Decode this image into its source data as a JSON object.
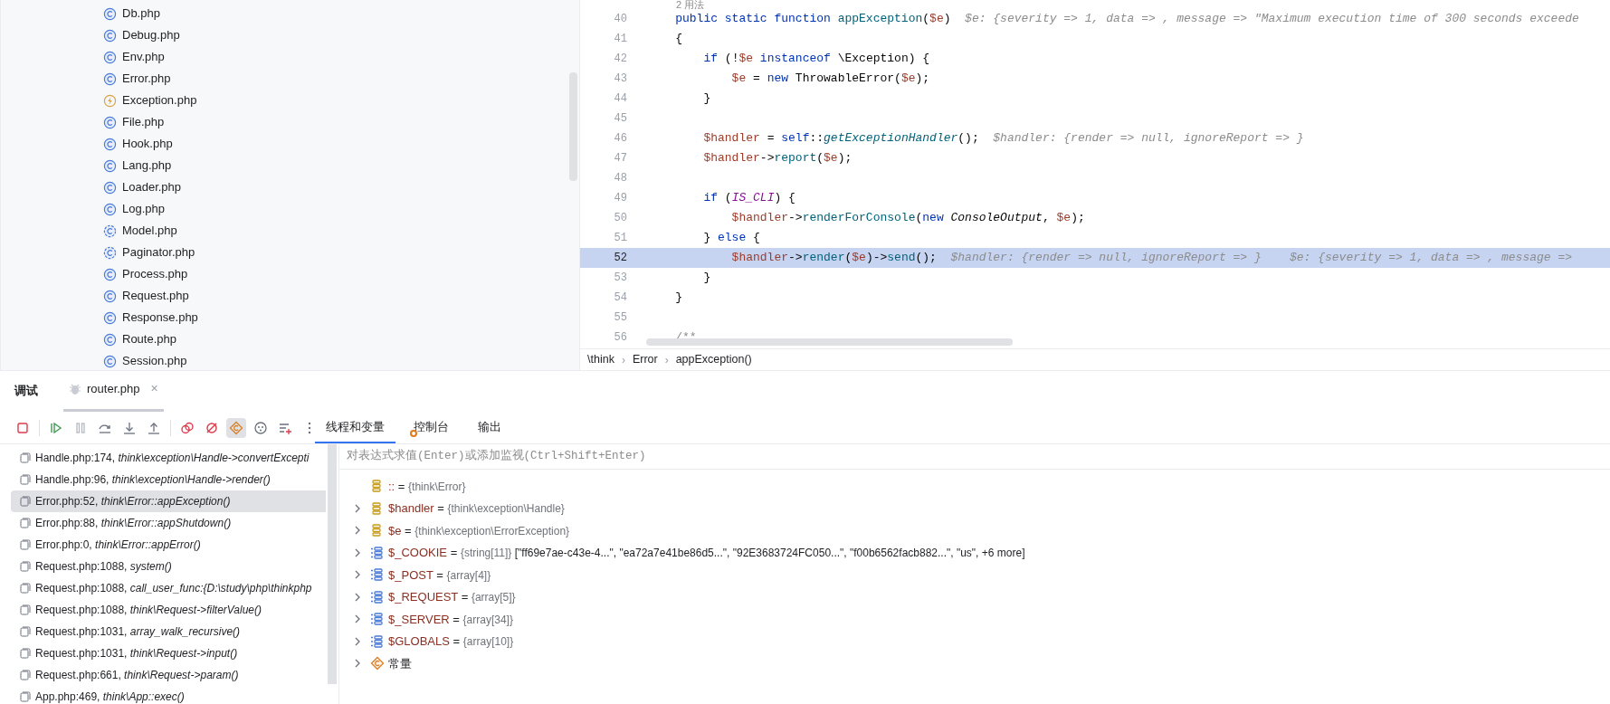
{
  "project_tree": {
    "files": [
      {
        "name": "Db.php",
        "kind": "class"
      },
      {
        "name": "Debug.php",
        "kind": "class"
      },
      {
        "name": "Env.php",
        "kind": "class"
      },
      {
        "name": "Error.php",
        "kind": "class"
      },
      {
        "name": "Exception.php",
        "kind": "exception"
      },
      {
        "name": "File.php",
        "kind": "class"
      },
      {
        "name": "Hook.php",
        "kind": "class"
      },
      {
        "name": "Lang.php",
        "kind": "class"
      },
      {
        "name": "Loader.php",
        "kind": "class"
      },
      {
        "name": "Log.php",
        "kind": "class"
      },
      {
        "name": "Model.php",
        "kind": "abstract"
      },
      {
        "name": "Paginator.php",
        "kind": "abstract"
      },
      {
        "name": "Process.php",
        "kind": "class"
      },
      {
        "name": "Request.php",
        "kind": "class"
      },
      {
        "name": "Response.php",
        "kind": "class"
      },
      {
        "name": "Route.php",
        "kind": "class"
      },
      {
        "name": "Session.php",
        "kind": "class"
      }
    ]
  },
  "editor": {
    "usages_hint": "2 用法",
    "lines": [
      {
        "number": "40",
        "current": false,
        "tokens": [
          {
            "text": "    public static function ",
            "kind": "kw"
          },
          {
            "text": "appException",
            "kind": "fn"
          },
          {
            "text": "(",
            "kind": "plain"
          },
          {
            "text": "$e",
            "kind": "var"
          },
          {
            "text": ")",
            "kind": "plain"
          },
          {
            "text": "  $e: {severity => 1, data => , message => \"Maximum execution time of 300 seconds exceede",
            "kind": "hint"
          }
        ]
      },
      {
        "number": "41",
        "current": false,
        "tokens": [
          {
            "text": "    {",
            "kind": "plain"
          }
        ]
      },
      {
        "number": "42",
        "current": false,
        "tokens": [
          {
            "text": "        if ",
            "kind": "kw"
          },
          {
            "text": "(!",
            "kind": "plain"
          },
          {
            "text": "$e",
            "kind": "var"
          },
          {
            "text": " instanceof ",
            "kind": "kw"
          },
          {
            "text": "\\Exception) {",
            "kind": "plain"
          }
        ]
      },
      {
        "number": "43",
        "current": false,
        "tokens": [
          {
            "text": "            $e",
            "kind": "var"
          },
          {
            "text": " = ",
            "kind": "plain"
          },
          {
            "text": "new ",
            "kind": "kw"
          },
          {
            "text": "ThrowableError(",
            "kind": "plain"
          },
          {
            "text": "$e",
            "kind": "var"
          },
          {
            "text": ");",
            "kind": "plain"
          }
        ]
      },
      {
        "number": "44",
        "current": false,
        "tokens": [
          {
            "text": "        }",
            "kind": "plain"
          }
        ]
      },
      {
        "number": "45",
        "current": false
      },
      {
        "number": "46",
        "current": false,
        "tokens": [
          {
            "text": "        $handler",
            "kind": "var"
          },
          {
            "text": " = ",
            "kind": "plain"
          },
          {
            "text": "self",
            "kind": "kw"
          },
          {
            "text": "::",
            "kind": "plain"
          },
          {
            "text": "getExceptionHandler",
            "kind": "static-call"
          },
          {
            "text": "();",
            "kind": "plain"
          },
          {
            "text": "  $handler: {render => null, ignoreReport => }",
            "kind": "hint"
          }
        ]
      },
      {
        "number": "47",
        "current": false,
        "tokens": [
          {
            "text": "        $handler",
            "kind": "var"
          },
          {
            "text": "->",
            "kind": "plain"
          },
          {
            "text": "report",
            "kind": "fn"
          },
          {
            "text": "(",
            "kind": "plain"
          },
          {
            "text": "$e",
            "kind": "var"
          },
          {
            "text": ");",
            "kind": "plain"
          }
        ]
      },
      {
        "number": "48",
        "current": false
      },
      {
        "number": "49",
        "current": false,
        "tokens": [
          {
            "text": "        if ",
            "kind": "kw"
          },
          {
            "text": "(",
            "kind": "plain"
          },
          {
            "text": "IS_CLI",
            "kind": "const"
          },
          {
            "text": ") {",
            "kind": "plain"
          }
        ]
      },
      {
        "number": "50",
        "current": false,
        "tokens": [
          {
            "text": "            $handler",
            "kind": "var"
          },
          {
            "text": "->",
            "kind": "plain"
          },
          {
            "text": "renderForConsole",
            "kind": "fn"
          },
          {
            "text": "(",
            "kind": "plain"
          },
          {
            "text": "new ",
            "kind": "kw"
          },
          {
            "text": "ConsoleOutput",
            "kind": "class-ref"
          },
          {
            "text": ", ",
            "kind": "plain"
          },
          {
            "text": "$e",
            "kind": "var"
          },
          {
            "text": ");",
            "kind": "plain"
          }
        ]
      },
      {
        "number": "51",
        "current": false,
        "tokens": [
          {
            "text": "        } ",
            "kind": "plain"
          },
          {
            "text": "else",
            "kind": "kw"
          },
          {
            "text": " {",
            "kind": "plain"
          }
        ]
      },
      {
        "number": "52",
        "current": true,
        "tokens": [
          {
            "text": "            $handler",
            "kind": "var"
          },
          {
            "text": "->",
            "kind": "plain"
          },
          {
            "text": "render",
            "kind": "fn"
          },
          {
            "text": "(",
            "kind": "plain"
          },
          {
            "text": "$e",
            "kind": "var"
          },
          {
            "text": ")->",
            "kind": "plain"
          },
          {
            "text": "send",
            "kind": "fn"
          },
          {
            "text": "();",
            "kind": "plain"
          },
          {
            "text": "  $handler: {render => null, ignoreReport => }    $e: {severity => 1, data => , message =>",
            "kind": "hint"
          }
        ]
      },
      {
        "number": "53",
        "current": false,
        "tokens": [
          {
            "text": "        }",
            "kind": "plain"
          }
        ]
      },
      {
        "number": "54",
        "current": false,
        "tokens": [
          {
            "text": "    }",
            "kind": "plain"
          }
        ]
      },
      {
        "number": "55",
        "current": false
      },
      {
        "number": "56",
        "current": false,
        "tokens": [
          {
            "text": "    /**",
            "kind": "comment"
          }
        ]
      }
    ],
    "breadcrumb": {
      "separator": "›",
      "items": [
        "\\think",
        "Error",
        "appException()"
      ]
    }
  },
  "debug_panel": {
    "title": "调试",
    "session_tab": {
      "label": "router.php",
      "selected": true,
      "close": "×"
    },
    "toolbar": [
      {
        "kind": "stop",
        "disabled": false,
        "selected": false
      },
      {
        "kind": "resume",
        "disabled": false,
        "selected": false
      },
      {
        "kind": "pause",
        "disabled": true,
        "selected": false
      },
      {
        "kind": "step-over",
        "disabled": false,
        "selected": false
      },
      {
        "kind": "step-into",
        "disabled": false,
        "selected": false
      },
      {
        "kind": "step-out",
        "disabled": false,
        "selected": false
      },
      {
        "kind": "breakpoints",
        "disabled": false,
        "selected": false
      },
      {
        "kind": "mute",
        "disabled": false,
        "selected": false
      },
      {
        "kind": "exceptions",
        "disabled": false,
        "selected": true
      },
      {
        "kind": "dots-circle",
        "disabled": false,
        "selected": false
      },
      {
        "kind": "add-list",
        "disabled": false,
        "selected": false
      },
      {
        "kind": "more",
        "disabled": false,
        "selected": false
      }
    ],
    "tabs": [
      {
        "label": "线程和变量",
        "selected": true,
        "badge": false
      },
      {
        "label": "控制台",
        "selected": false,
        "badge": true
      },
      {
        "label": "输出",
        "selected": false,
        "badge": false
      }
    ],
    "frames": [
      {
        "location": "Handle.php:174, ",
        "method": "think\\exception\\Handle->convertExcepti",
        "selected": false
      },
      {
        "location": "Handle.php:96, ",
        "method": "think\\exception\\Handle->render()",
        "selected": false
      },
      {
        "location": "Error.php:52, ",
        "method": "think\\Error::appException()",
        "selected": true
      },
      {
        "location": "Error.php:88, ",
        "method": "think\\Error::appShutdown()",
        "selected": false
      },
      {
        "location": "Error.php:0, ",
        "method": "think\\Error::appError()",
        "selected": false
      },
      {
        "location": "Request.php:1088, ",
        "method": "system()",
        "selected": false
      },
      {
        "location": "Request.php:1088, ",
        "method": "call_user_func:{D:\\study\\php\\thinkphp",
        "selected": false
      },
      {
        "location": "Request.php:1088, ",
        "method": "think\\Request->filterValue()",
        "selected": false
      },
      {
        "location": "Request.php:1031, ",
        "method": "array_walk_recursive()",
        "selected": false
      },
      {
        "location": "Request.php:1031, ",
        "method": "think\\Request->input()",
        "selected": false
      },
      {
        "location": "Request.php:661, ",
        "method": "think\\Request->param()",
        "selected": false
      },
      {
        "location": "App.php:469, ",
        "method": "think\\App::exec()",
        "selected": false
      }
    ],
    "evaluate_field": {
      "placeholder": "对表达式求值(Enter)或添加监视(Ctrl+Shift+Enter)"
    },
    "variables": [
      {
        "kind": "object",
        "expandable": false,
        "name": "::",
        "equals": "=",
        "type": "{think\\Error}"
      },
      {
        "kind": "object",
        "expandable": true,
        "name": "$handler",
        "equals": "=",
        "type": "{think\\exception\\Handle}"
      },
      {
        "kind": "object",
        "expandable": true,
        "name": "$e",
        "equals": "=",
        "type": "{think\\exception\\ErrorException}"
      },
      {
        "kind": "array",
        "expandable": true,
        "name": "$_COOKIE",
        "equals": "=",
        "type": "{string[11]}",
        "preview": "[\"ff69e7ae-c43e-4...\", \"ea72a7e41be86d5...\", \"92E3683724FC050...\", \"f00b6562facb882...\", \"us\", +6 more]"
      },
      {
        "kind": "array",
        "expandable": true,
        "name": "$_POST",
        "equals": "=",
        "type": "{array[4]}"
      },
      {
        "kind": "array",
        "expandable": true,
        "name": "$_REQUEST",
        "equals": "=",
        "type": "{array[5]}"
      },
      {
        "kind": "array",
        "expandable": true,
        "name": "$_SERVER",
        "equals": "=",
        "type": "{array[34]}"
      },
      {
        "kind": "array",
        "expandable": true,
        "name": "$GLOBALS",
        "equals": "=",
        "type": "{array[10]}"
      },
      {
        "kind": "constants",
        "expandable": true,
        "name": "常量"
      }
    ]
  }
}
